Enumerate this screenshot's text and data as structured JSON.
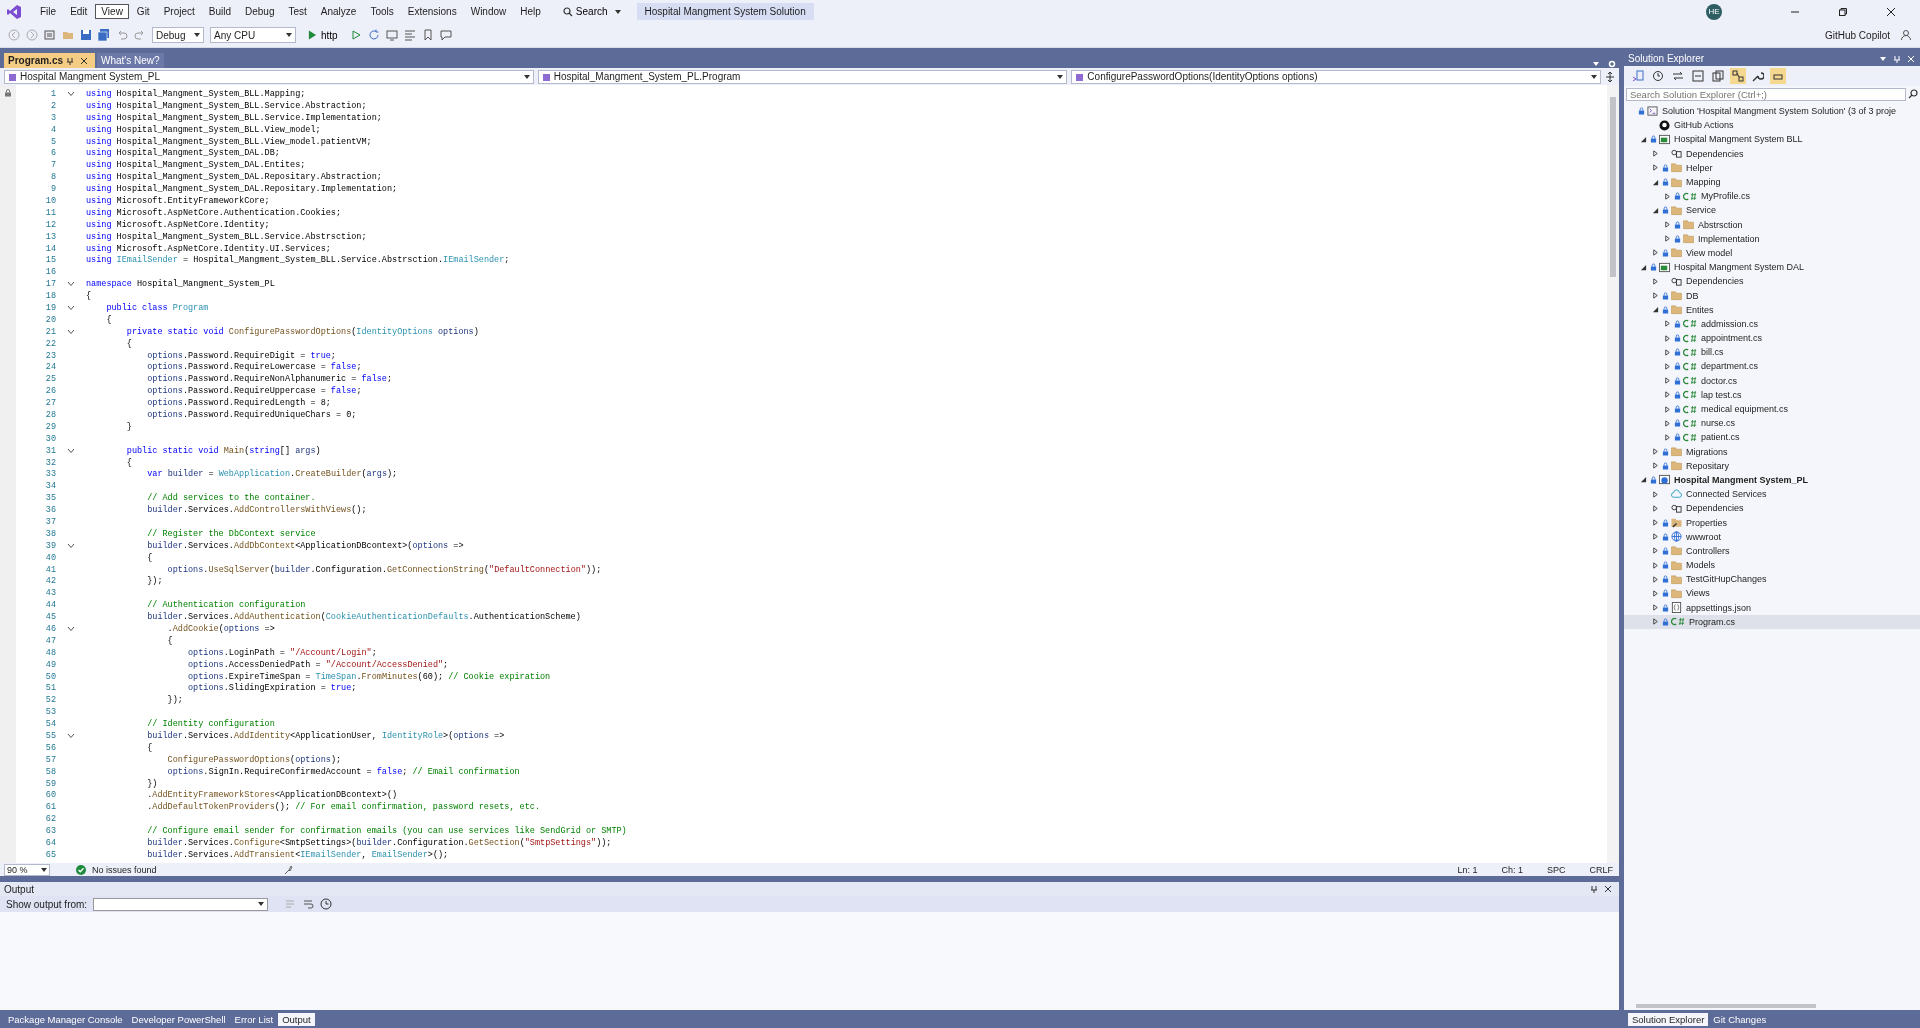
{
  "menu": [
    {
      "label": "File",
      "selected": false
    },
    {
      "label": "Edit",
      "selected": false
    },
    {
      "label": "View",
      "selected": true
    },
    {
      "label": "Git",
      "selected": false
    },
    {
      "label": "Project",
      "selected": false
    },
    {
      "label": "Build",
      "selected": false
    },
    {
      "label": "Debug",
      "selected": false
    },
    {
      "label": "Test",
      "selected": false
    },
    {
      "label": "Analyze",
      "selected": false
    },
    {
      "label": "Tools",
      "selected": false
    },
    {
      "label": "Extensions",
      "selected": false
    },
    {
      "label": "Window",
      "selected": false
    },
    {
      "label": "Help",
      "selected": false
    }
  ],
  "search": {
    "label": "Search"
  },
  "solution_title": "Hospital Mangment System Solution",
  "account": {
    "initials": "HE"
  },
  "copilot": "GitHub Copilot",
  "toolbar": {
    "configuration": "Debug",
    "platform": "Any CPU",
    "run": "http"
  },
  "document_tabs": [
    {
      "label": "Program.cs",
      "selected": true
    },
    {
      "label": "What's New?",
      "selected": false
    }
  ],
  "navigation": [
    "Hospital Mangment System_PL",
    "Hospital_Mangment_System_PL.Program",
    "ConfigurePasswordOptions(IdentityOptions options)"
  ],
  "code": [
    {
      "n": "1",
      "fold": true,
      "code": [
        {
          "kind": "keyword",
          "text": "using"
        },
        {
          "kind": "plain",
          "text": " Hospital_Mangment_System_BLL.Mapping;"
        }
      ]
    },
    {
      "n": "2",
      "fold": false,
      "code": [
        {
          "kind": "keyword",
          "text": "using"
        },
        {
          "kind": "plain",
          "text": " Hospital_Mangment_System_BLL.Service.Abstraction;"
        }
      ]
    },
    {
      "n": "3",
      "fold": false,
      "code": [
        {
          "kind": "keyword",
          "text": "using"
        },
        {
          "kind": "plain",
          "text": " Hospital_Mangment_System_BLL.Service.Implementation;"
        }
      ]
    },
    {
      "n": "4",
      "fold": false,
      "code": [
        {
          "kind": "keyword",
          "text": "using"
        },
        {
          "kind": "plain",
          "text": " Hospital_Mangment_System_BLL.View_model;"
        }
      ]
    },
    {
      "n": "5",
      "fold": false,
      "code": [
        {
          "kind": "keyword",
          "text": "using"
        },
        {
          "kind": "plain",
          "text": " Hospital_Mangment_System_BLL.View_model.patientVM;"
        }
      ]
    },
    {
      "n": "6",
      "fold": false,
      "code": [
        {
          "kind": "keyword",
          "text": "using"
        },
        {
          "kind": "plain",
          "text": " Hospital_Mangment_System_DAL.DB;"
        }
      ]
    },
    {
      "n": "7",
      "fold": false,
      "code": [
        {
          "kind": "keyword",
          "text": "using"
        },
        {
          "kind": "plain",
          "text": " Hospital_Mangment_System_DAL.Entites;"
        }
      ]
    },
    {
      "n": "8",
      "fold": false,
      "code": [
        {
          "kind": "keyword",
          "text": "using"
        },
        {
          "kind": "plain",
          "text": " Hospital_Mangment_System_DAL.Repositary.Abstraction;"
        }
      ]
    },
    {
      "n": "9",
      "fold": false,
      "code": [
        {
          "kind": "keyword",
          "text": "using"
        },
        {
          "kind": "plain",
          "text": " Hospital_Mangment_System_DAL.Repositary.Implementation;"
        }
      ]
    },
    {
      "n": "10",
      "fold": false,
      "code": [
        {
          "kind": "keyword",
          "text": "using"
        },
        {
          "kind": "plain",
          "text": " Microsoft.EntityFrameworkCore;"
        }
      ]
    },
    {
      "n": "11",
      "fold": false,
      "code": [
        {
          "kind": "keyword",
          "text": "using"
        },
        {
          "kind": "plain",
          "text": " Microsoft.AspNetCore.Authentication.Cookies;"
        }
      ]
    },
    {
      "n": "12",
      "fold": false,
      "code": [
        {
          "kind": "keyword",
          "text": "using"
        },
        {
          "kind": "plain",
          "text": " Microsoft.AspNetCore.Identity;"
        }
      ]
    },
    {
      "n": "13",
      "fold": false,
      "code": [
        {
          "kind": "keyword",
          "text": "using"
        },
        {
          "kind": "plain",
          "text": " Hospital_Mangment_System_BLL.Service.Abstrsction;"
        }
      ]
    },
    {
      "n": "14",
      "fold": false,
      "code": [
        {
          "kind": "keyword",
          "text": "using"
        },
        {
          "kind": "plain",
          "text": " Microsoft.AspNetCore.Identity.UI.Services;"
        }
      ]
    },
    {
      "n": "15",
      "fold": false,
      "code": [
        {
          "kind": "keyword",
          "text": "using "
        },
        {
          "kind": "type",
          "text": "IEmailSender"
        },
        {
          "kind": "plain",
          "text": " = Hospital_Mangment_System_BLL.Service.Abstrsction."
        },
        {
          "kind": "type",
          "text": "IEmailSender"
        },
        {
          "kind": "plain",
          "text": ";"
        }
      ]
    },
    {
      "n": "16",
      "fold": false
    },
    {
      "n": "17",
      "fold": true,
      "code": [
        {
          "kind": "keyword",
          "text": "namespace"
        },
        {
          "kind": "plain",
          "text": " Hospital_Mangment_System_PL"
        }
      ]
    },
    {
      "n": "18",
      "fold": false,
      "code": [
        {
          "kind": "plain",
          "text": "{"
        }
      ]
    },
    {
      "n": "19",
      "fold": true,
      "code": [
        {
          "kind": "keyword",
          "text": "    public class "
        },
        {
          "kind": "type",
          "text": "Program"
        }
      ]
    },
    {
      "n": "20",
      "fold": false,
      "code": [
        {
          "kind": "plain",
          "text": "    {"
        }
      ]
    },
    {
      "n": "21",
      "fold": true,
      "code": [
        {
          "kind": "keyword",
          "text": "        private static void "
        },
        {
          "kind": "method",
          "text": "ConfigurePasswordOptions"
        },
        {
          "kind": "plain",
          "text": "("
        },
        {
          "kind": "type",
          "text": "IdentityOptions "
        },
        {
          "kind": "variable",
          "text": "options"
        },
        {
          "kind": "plain",
          "text": ")"
        }
      ]
    },
    {
      "n": "22",
      "fold": false,
      "code": [
        {
          "kind": "plain",
          "text": "        {"
        }
      ]
    },
    {
      "n": "23",
      "fold": false,
      "code": [
        {
          "kind": "variable",
          "text": "            options"
        },
        {
          "kind": "plain",
          "text": ".Password.RequireDigit = "
        },
        {
          "kind": "keyword",
          "text": "true"
        },
        {
          "kind": "plain",
          "text": ";"
        }
      ]
    },
    {
      "n": "24",
      "fold": false,
      "code": [
        {
          "kind": "variable",
          "text": "            options"
        },
        {
          "kind": "plain",
          "text": ".Password.RequireLowercase = "
        },
        {
          "kind": "keyword",
          "text": "false"
        },
        {
          "kind": "plain",
          "text": ";"
        }
      ]
    },
    {
      "n": "25",
      "fold": false,
      "code": [
        {
          "kind": "variable",
          "text": "            options"
        },
        {
          "kind": "plain",
          "text": ".Password.RequireNonAlphanumeric = "
        },
        {
          "kind": "keyword",
          "text": "false"
        },
        {
          "kind": "plain",
          "text": ";"
        }
      ]
    },
    {
      "n": "26",
      "fold": false,
      "code": [
        {
          "kind": "variable",
          "text": "            options"
        },
        {
          "kind": "plain",
          "text": ".Password.RequireUppercase = "
        },
        {
          "kind": "keyword",
          "text": "false"
        },
        {
          "kind": "plain",
          "text": ";"
        }
      ]
    },
    {
      "n": "27",
      "fold": false,
      "code": [
        {
          "kind": "variable",
          "text": "            options"
        },
        {
          "kind": "plain",
          "text": ".Password.RequiredLength = 8;"
        }
      ]
    },
    {
      "n": "28",
      "fold": false,
      "code": [
        {
          "kind": "variable",
          "text": "            options"
        },
        {
          "kind": "plain",
          "text": ".Password.RequiredUniqueChars = 0;"
        }
      ]
    },
    {
      "n": "29",
      "fold": false,
      "code": [
        {
          "kind": "plain",
          "text": "        }"
        }
      ]
    },
    {
      "n": "30",
      "fold": false
    },
    {
      "n": "31",
      "fold": true,
      "code": [
        {
          "kind": "keyword",
          "text": "        public static void "
        },
        {
          "kind": "method",
          "text": "Main"
        },
        {
          "kind": "plain",
          "text": "("
        },
        {
          "kind": "keyword",
          "text": "string"
        },
        {
          "kind": "plain",
          "text": "[] "
        },
        {
          "kind": "variable",
          "text": "args"
        },
        {
          "kind": "plain",
          "text": ")"
        }
      ]
    },
    {
      "n": "32",
      "fold": false,
      "code": [
        {
          "kind": "plain",
          "text": "        {"
        }
      ]
    },
    {
      "n": "33",
      "fold": false,
      "code": [
        {
          "kind": "keyword",
          "text": "            var "
        },
        {
          "kind": "variable",
          "text": "builder"
        },
        {
          "kind": "plain",
          "text": " = "
        },
        {
          "kind": "type",
          "text": "WebApplication"
        },
        {
          "kind": "plain",
          "text": "."
        },
        {
          "kind": "method",
          "text": "CreateBuilder"
        },
        {
          "kind": "plain",
          "text": "("
        },
        {
          "kind": "variable",
          "text": "args"
        },
        {
          "kind": "plain",
          "text": ");"
        }
      ]
    },
    {
      "n": "34",
      "fold": false
    },
    {
      "n": "35",
      "fold": false,
      "code": [
        {
          "kind": "comment",
          "text": "            // Add services to the container."
        }
      ]
    },
    {
      "n": "36",
      "fold": false,
      "code": [
        {
          "kind": "variable",
          "text": "            builder"
        },
        {
          "kind": "plain",
          "text": ".Services."
        },
        {
          "kind": "method",
          "text": "AddControllersWithViews"
        },
        {
          "kind": "plain",
          "text": "();"
        }
      ]
    },
    {
      "n": "37",
      "fold": false
    },
    {
      "n": "38",
      "fold": false,
      "code": [
        {
          "kind": "comment",
          "text": "            // Register the DbContext service"
        }
      ]
    },
    {
      "n": "39",
      "fold": true,
      "code": [
        {
          "kind": "variable",
          "text": "            builder"
        },
        {
          "kind": "plain",
          "text": ".Services."
        },
        {
          "kind": "method",
          "text": "AddDbContext"
        },
        {
          "kind": "plain",
          "text": "<ApplicationDBcontext>("
        },
        {
          "kind": "variable",
          "text": "options"
        },
        {
          "kind": "plain",
          "text": " =>"
        }
      ]
    },
    {
      "n": "40",
      "fold": false,
      "code": [
        {
          "kind": "plain",
          "text": "            {"
        }
      ]
    },
    {
      "n": "41",
      "fold": false,
      "code": [
        {
          "kind": "variable",
          "text": "                options"
        },
        {
          "kind": "plain",
          "text": "."
        },
        {
          "kind": "method",
          "text": "UseSqlServer"
        },
        {
          "kind": "plain",
          "text": "("
        },
        {
          "kind": "variable",
          "text": "builder"
        },
        {
          "kind": "plain",
          "text": ".Configuration."
        },
        {
          "kind": "method",
          "text": "GetConnectionString"
        },
        {
          "kind": "plain",
          "text": "("
        },
        {
          "kind": "string",
          "text": "\"DefaultConnection\""
        },
        {
          "kind": "plain",
          "text": "));"
        }
      ]
    },
    {
      "n": "42",
      "fold": false,
      "code": [
        {
          "kind": "plain",
          "text": "            });"
        }
      ]
    },
    {
      "n": "43",
      "fold": false
    },
    {
      "n": "44",
      "fold": false,
      "code": [
        {
          "kind": "comment",
          "text": "            // Authentication configuration"
        }
      ]
    },
    {
      "n": "45",
      "fold": false,
      "code": [
        {
          "kind": "variable",
          "text": "            builder"
        },
        {
          "kind": "plain",
          "text": ".Services."
        },
        {
          "kind": "method",
          "text": "AddAuthentication"
        },
        {
          "kind": "plain",
          "text": "("
        },
        {
          "kind": "type",
          "text": "CookieAuthenticationDefaults"
        },
        {
          "kind": "plain",
          "text": ".AuthenticationScheme)"
        }
      ]
    },
    {
      "n": "46",
      "fold": true,
      "code": [
        {
          "kind": "plain",
          "text": "                ."
        },
        {
          "kind": "method",
          "text": "AddCookie"
        },
        {
          "kind": "plain",
          "text": "("
        },
        {
          "kind": "variable",
          "text": "options"
        },
        {
          "kind": "plain",
          "text": " =>"
        }
      ]
    },
    {
      "n": "47",
      "fold": false,
      "code": [
        {
          "kind": "plain",
          "text": "                {"
        }
      ]
    },
    {
      "n": "48",
      "fold": false,
      "code": [
        {
          "kind": "variable",
          "text": "                    options"
        },
        {
          "kind": "plain",
          "text": ".LoginPath = "
        },
        {
          "kind": "string",
          "text": "\"/Account/Login\""
        },
        {
          "kind": "plain",
          "text": ";"
        }
      ]
    },
    {
      "n": "49",
      "fold": false,
      "code": [
        {
          "kind": "variable",
          "text": "                    options"
        },
        {
          "kind": "plain",
          "text": ".AccessDeniedPath = "
        },
        {
          "kind": "string",
          "text": "\"/Account/AccessDenied\""
        },
        {
          "kind": "plain",
          "text": ";"
        }
      ]
    },
    {
      "n": "50",
      "fold": false,
      "code": [
        {
          "kind": "variable",
          "text": "                    options"
        },
        {
          "kind": "plain",
          "text": ".ExpireTimeSpan = "
        },
        {
          "kind": "type",
          "text": "TimeSpan"
        },
        {
          "kind": "plain",
          "text": "."
        },
        {
          "kind": "method",
          "text": "FromMinutes"
        },
        {
          "kind": "plain",
          "text": "(60); "
        },
        {
          "kind": "comment",
          "text": "// Cookie expiration"
        }
      ]
    },
    {
      "n": "51",
      "fold": false,
      "code": [
        {
          "kind": "variable",
          "text": "                    options"
        },
        {
          "kind": "plain",
          "text": ".SlidingExpiration = "
        },
        {
          "kind": "keyword",
          "text": "true"
        },
        {
          "kind": "plain",
          "text": ";"
        }
      ]
    },
    {
      "n": "52",
      "fold": false,
      "code": [
        {
          "kind": "plain",
          "text": "                });"
        }
      ]
    },
    {
      "n": "53",
      "fold": false
    },
    {
      "n": "54",
      "fold": false,
      "code": [
        {
          "kind": "comment",
          "text": "            // Identity configuration"
        }
      ]
    },
    {
      "n": "55",
      "fold": true,
      "code": [
        {
          "kind": "variable",
          "text": "            builder"
        },
        {
          "kind": "plain",
          "text": ".Services."
        },
        {
          "kind": "method",
          "text": "AddIdentity"
        },
        {
          "kind": "plain",
          "text": "<ApplicationUser, "
        },
        {
          "kind": "type",
          "text": "IdentityRole"
        },
        {
          "kind": "plain",
          "text": ">("
        },
        {
          "kind": "variable",
          "text": "options"
        },
        {
          "kind": "plain",
          "text": " =>"
        }
      ]
    },
    {
      "n": "56",
      "fold": false,
      "code": [
        {
          "kind": "plain",
          "text": "            {"
        }
      ]
    },
    {
      "n": "57",
      "fold": false,
      "code": [
        {
          "kind": "method",
          "text": "                ConfigurePasswordOptions"
        },
        {
          "kind": "plain",
          "text": "("
        },
        {
          "kind": "variable",
          "text": "options"
        },
        {
          "kind": "plain",
          "text": ");"
        }
      ]
    },
    {
      "n": "58",
      "fold": false,
      "code": [
        {
          "kind": "variable",
          "text": "                options"
        },
        {
          "kind": "plain",
          "text": ".SignIn.RequireConfirmedAccount = "
        },
        {
          "kind": "keyword",
          "text": "false"
        },
        {
          "kind": "plain",
          "text": "; "
        },
        {
          "kind": "comment",
          "text": "// Email confirmation"
        }
      ]
    },
    {
      "n": "59",
      "fold": false,
      "code": [
        {
          "kind": "plain",
          "text": "            })"
        }
      ]
    },
    {
      "n": "60",
      "fold": false,
      "code": [
        {
          "kind": "plain",
          "text": "            ."
        },
        {
          "kind": "method",
          "text": "AddEntityFrameworkStores"
        },
        {
          "kind": "plain",
          "text": "<ApplicationDBcontext>()"
        }
      ]
    },
    {
      "n": "61",
      "fold": false,
      "code": [
        {
          "kind": "plain",
          "text": "            ."
        },
        {
          "kind": "method",
          "text": "AddDefaultTokenProviders"
        },
        {
          "kind": "plain",
          "text": "(); "
        },
        {
          "kind": "comment",
          "text": "// For email confirmation, password resets, etc."
        }
      ]
    },
    {
      "n": "62",
      "fold": false
    },
    {
      "n": "63",
      "fold": false,
      "code": [
        {
          "kind": "comment",
          "text": "            // Configure email sender for confirmation emails (you can use services like SendGrid or SMTP)"
        }
      ]
    },
    {
      "n": "64",
      "fold": false,
      "code": [
        {
          "kind": "variable",
          "text": "            builder"
        },
        {
          "kind": "plain",
          "text": ".Services."
        },
        {
          "kind": "method",
          "text": "Configure"
        },
        {
          "kind": "plain",
          "text": "<SmtpSettings>("
        },
        {
          "kind": "variable",
          "text": "builder"
        },
        {
          "kind": "plain",
          "text": ".Configuration."
        },
        {
          "kind": "method",
          "text": "GetSection"
        },
        {
          "kind": "plain",
          "text": "("
        },
        {
          "kind": "string",
          "text": "\"SmtpSettings\""
        },
        {
          "kind": "plain",
          "text": "));"
        }
      ]
    },
    {
      "n": "65",
      "fold": false,
      "code": [
        {
          "kind": "variable",
          "text": "            builder"
        },
        {
          "kind": "plain",
          "text": ".Services."
        },
        {
          "kind": "method",
          "text": "AddTransient"
        },
        {
          "kind": "plain",
          "text": "<"
        },
        {
          "kind": "type",
          "text": "IEmailSender"
        },
        {
          "kind": "plain",
          "text": ", "
        },
        {
          "kind": "type",
          "text": "EmailSender"
        },
        {
          "kind": "plain",
          "text": ">();"
        }
      ]
    }
  ],
  "status_bar": {
    "zoom": "90 %",
    "issues": "No issues found",
    "line": "Ln: 1",
    "column": "Ch: 1",
    "whitespace": "SPC",
    "line_endings": "CRLF"
  },
  "output": {
    "title": "Output",
    "source_label": "Show output from:"
  },
  "bottom_tabs": [
    {
      "label": "Package Manager Console",
      "selected": false
    },
    {
      "label": "Developer PowerShell",
      "selected": false
    },
    {
      "label": "Error List",
      "selected": false
    },
    {
      "label": "Output",
      "selected": true
    }
  ],
  "solution_explorer": {
    "title": "Solution Explorer",
    "search": {
      "placeholder": "Search Solution Explorer (Ctrl+;)"
    },
    "tree": [
      {
        "label": "Solution 'Hospital Mangment System Solution' (3 of 3 proje",
        "kind": "solution",
        "locked": true,
        "selected": false,
        "children": [
          {
            "label": "GitHub Actions",
            "kind": "github",
            "locked": false,
            "selected": false
          },
          {
            "label": "Hospital Mangment System BLL",
            "kind": "project",
            "startup": false,
            "expanded": true,
            "locked": true,
            "selected": false,
            "children": [
              {
                "label": "Dependencies",
                "kind": "dependencies",
                "expanded": false,
                "locked": false,
                "selected": false
              },
              {
                "label": "Helper",
                "kind": "folder",
                "expanded": false,
                "locked": true,
                "selected": false
              },
              {
                "label": "Mapping",
                "kind": "folder",
                "expanded": true,
                "locked": true,
                "selected": false,
                "children": [
                  {
                    "label": "MyProfile.cs",
                    "kind": "csharp",
                    "expanded": false,
                    "locked": true,
                    "selected": false
                  }
                ]
              },
              {
                "label": "Service",
                "kind": "folder",
                "expanded": true,
                "locked": true,
                "selected": false,
                "children": [
                  {
                    "label": "Abstrsction",
                    "kind": "folder",
                    "expanded": false,
                    "locked": true,
                    "selected": false
                  },
                  {
                    "label": "Implementation",
                    "kind": "folder",
                    "expanded": false,
                    "locked": true,
                    "selected": false
                  }
                ]
              },
              {
                "label": "View model",
                "kind": "folder",
                "expanded": false,
                "locked": true,
                "selected": false
              }
            ]
          },
          {
            "label": "Hospital Mangment System DAL",
            "kind": "project",
            "startup": false,
            "expanded": true,
            "locked": true,
            "selected": false,
            "children": [
              {
                "label": "Dependencies",
                "kind": "dependencies",
                "expanded": false,
                "locked": false,
                "selected": false
              },
              {
                "label": "DB",
                "kind": "folder",
                "expanded": false,
                "locked": true,
                "selected": false
              },
              {
                "label": "Entites",
                "kind": "folder",
                "expanded": true,
                "locked": true,
                "selected": false,
                "children": [
                  {
                    "label": "addmission.cs",
                    "kind": "csharp",
                    "expanded": false,
                    "locked": true,
                    "selected": false
                  },
                  {
                    "label": "appointment.cs",
                    "kind": "csharp",
                    "expanded": false,
                    "locked": true,
                    "selected": false
                  },
                  {
                    "label": "bill.cs",
                    "kind": "csharp",
                    "expanded": false,
                    "locked": true,
                    "selected": false
                  },
                  {
                    "label": "department.cs",
                    "kind": "csharp",
                    "expanded": false,
                    "locked": true,
                    "selected": false
                  },
                  {
                    "label": "doctor.cs",
                    "kind": "csharp",
                    "expanded": false,
                    "locked": true,
                    "selected": false
                  },
                  {
                    "label": "lap test.cs",
                    "kind": "csharp",
                    "expanded": false,
                    "locked": true,
                    "selected": false
                  },
                  {
                    "label": "medical equipment.cs",
                    "kind": "csharp",
                    "expanded": false,
                    "locked": true,
                    "selected": false
                  },
                  {
                    "label": "nurse.cs",
                    "kind": "csharp",
                    "expanded": false,
                    "locked": true,
                    "selected": false
                  },
                  {
                    "label": "patient.cs",
                    "kind": "csharp",
                    "expanded": false,
                    "locked": true,
                    "selected": false
                  }
                ]
              },
              {
                "label": "Migrations",
                "kind": "folder",
                "expanded": false,
                "locked": true,
                "selected": false
              },
              {
                "label": "Repositary",
                "kind": "folder",
                "expanded": false,
                "locked": true,
                "selected": false
              }
            ]
          },
          {
            "label": "Hospital Mangment System_PL",
            "kind": "webproject",
            "startup": true,
            "expanded": true,
            "locked": true,
            "selected": false,
            "children": [
              {
                "label": "Connected Services",
                "kind": "connected",
                "expanded": false,
                "locked": false,
                "selected": false
              },
              {
                "label": "Dependencies",
                "kind": "dependencies",
                "expanded": false,
                "locked": false,
                "selected": false
              },
              {
                "label": "Properties",
                "kind": "properties",
                "expanded": false,
                "locked": true,
                "selected": false
              },
              {
                "label": "wwwroot",
                "kind": "globe",
                "expanded": false,
                "locked": true,
                "selected": false
              },
              {
                "label": "Controllers",
                "kind": "folder",
                "expanded": false,
                "locked": true,
                "selected": false
              },
              {
                "label": "Models",
                "kind": "folder",
                "expanded": false,
                "locked": true,
                "selected": false
              },
              {
                "label": "TestGitHupChanges",
                "kind": "folder",
                "expanded": false,
                "locked": true,
                "selected": false
              },
              {
                "label": "Views",
                "kind": "folder",
                "expanded": false,
                "locked": true,
                "selected": false
              },
              {
                "label": "appsettings.json",
                "kind": "json",
                "expanded": false,
                "locked": true,
                "selected": false
              },
              {
                "label": "Program.cs",
                "kind": "csharp",
                "expanded": false,
                "locked": true,
                "selected": true
              }
            ]
          }
        ]
      }
    ]
  },
  "side_tabs": [
    {
      "label": "Solution Explorer",
      "selected": true
    },
    {
      "label": "Git Changes",
      "selected": false
    }
  ]
}
